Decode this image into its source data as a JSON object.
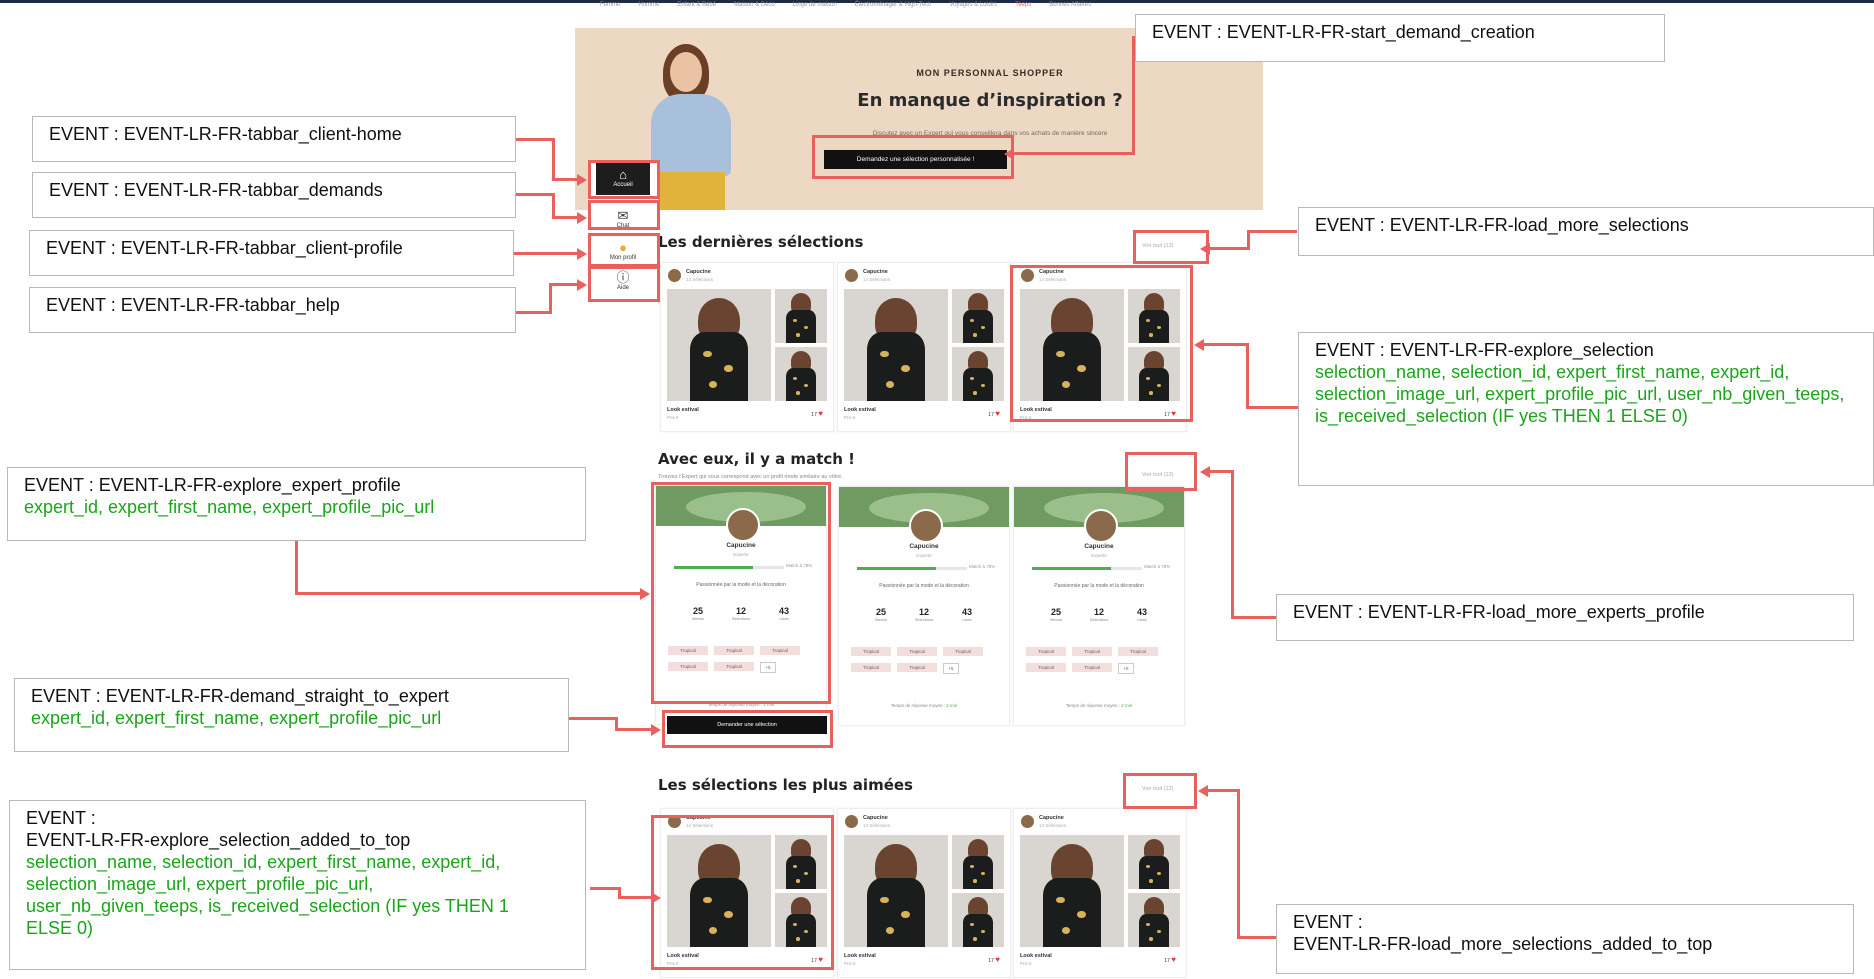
{
  "nav": {
    "items": [
      "Femme",
      "Homme",
      "Enfant & Bébé",
      "Maison & Déco",
      "Linge de maison",
      "Électroménager & High-Tech",
      "Voyages & Loisirs",
      "Teeps",
      "Bonnes Affaires"
    ]
  },
  "hero": {
    "kicker": "MON PERSONNAL SHOPPER",
    "title": "En manque d’inspiration ?",
    "subtitle": "Discutez avec un Expert qui vous conseillera dans vos achats de manière sincère",
    "cta": "Demandez une sélection personnalisée !"
  },
  "tabbar": {
    "home": "Accueil",
    "chat": "Chat",
    "profile": "Mon profil",
    "help": "Aide"
  },
  "latest": {
    "title": "Les dernières sélections",
    "see_all": "Voir tout (12)"
  },
  "match": {
    "title": "Avec eux, il y a match !",
    "subtitle": "Trouvez l’Expert qui vous correspond avec un profil mode similaire au vôtre.",
    "see_all": "Voir tout (12)",
    "ask_button": "Demander une sélection"
  },
  "top": {
    "title": "Les sélections les plus aimées",
    "see_all": "Voir tout (12)"
  },
  "selection_card": {
    "expert_name": "Capucine",
    "count": "14 Sélections",
    "look": "Look estival",
    "price": "Prix €",
    "likes": "17"
  },
  "expert_card": {
    "name": "Capucine",
    "role": "Experte",
    "match_progress": 0.72,
    "match": "Match à 78%",
    "bio": "Passionnée par la mode et la décoration",
    "stats": [
      {
        "value": "25",
        "label": "Mercis"
      },
      {
        "value": "12",
        "label": "Sélections"
      },
      {
        "value": "43",
        "label": "Likes"
      }
    ],
    "tag": "Tropical",
    "more": "+5",
    "response_time": "Temps de réponse moyen :",
    "response_value": "2 min"
  },
  "events": {
    "start_demand": "EVENT : EVENT-LR-FR-start_demand_creation",
    "tab_home": "EVENT : EVENT-LR-FR-tabbar_client-home",
    "tab_demands": "EVENT : EVENT-LR-FR-tabbar_demands",
    "tab_profile": "EVENT : EVENT-LR-FR-tabbar_client-profile",
    "tab_help": "EVENT : EVENT-LR-FR-tabbar_help",
    "load_more_selections": "EVENT : EVENT-LR-FR-load_more_selections",
    "explore_selection": "EVENT : EVENT-LR-FR-explore_selection",
    "explore_selection_params": "selection_name, selection_id, expert_first_name, expert_id, selection_image_url, expert_profile_pic_url, user_nb_given_teeps, is_received_selection (IF yes THEN 1 ELSE 0)",
    "explore_expert": "EVENT : EVENT-LR-FR-explore_expert_profile",
    "explore_expert_params": "expert_id, expert_first_name, expert_profile_pic_url",
    "load_more_experts": "EVENT : EVENT-LR-FR-load_more_experts_profile",
    "demand_to_expert": "EVENT : EVENT-LR-FR-demand_straight_to_expert",
    "demand_to_expert_params": "expert_id, expert_first_name, expert_profile_pic_url",
    "explore_top_line1": "EVENT :",
    "explore_top_line2": "EVENT-LR-FR-explore_selection_added_to_top",
    "explore_top_params": "selection_name, selection_id, expert_first_name, expert_id, selection_image_url, expert_profile_pic_url, user_nb_given_teeps, is_received_selection (IF yes THEN 1 ELSE 0)",
    "load_more_top_line1": "EVENT :",
    "load_more_top_line2": "EVENT-LR-FR-load_more_selections_added_to_top"
  },
  "colors": {
    "highlight": "#e8615f",
    "params_green": "#1aa51a",
    "cta_black": "#111111",
    "hero_bg": "#ecd8c3"
  }
}
